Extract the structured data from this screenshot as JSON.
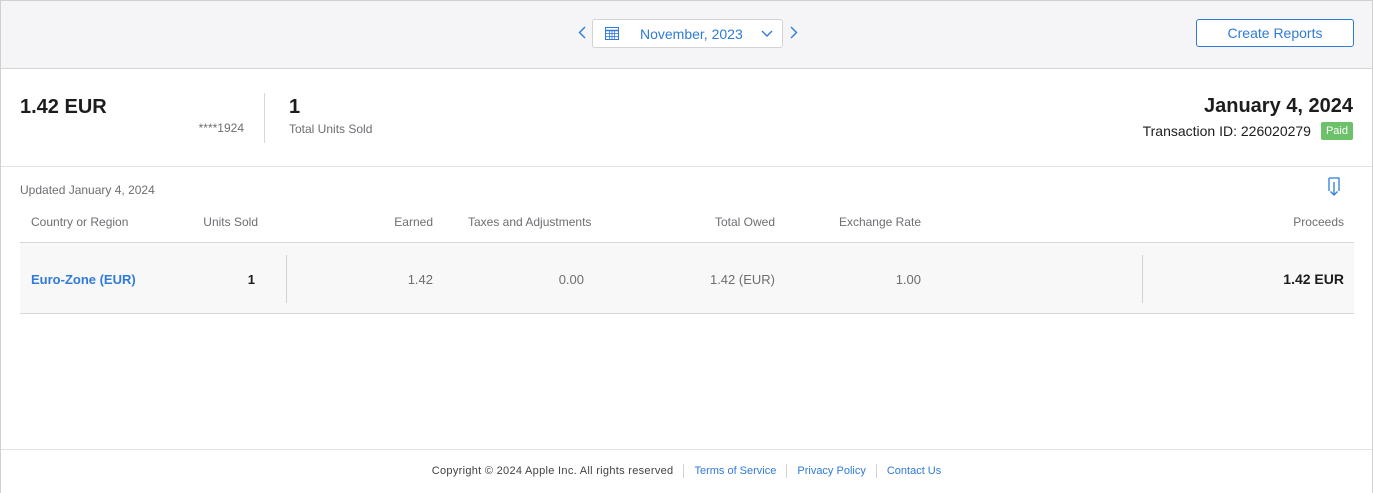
{
  "header": {
    "month": "November, 2023",
    "create_reports_label": "Create Reports",
    "icons": {
      "prev": "chevron-left-icon",
      "next": "chevron-right-icon",
      "calendar": "calendar-icon",
      "dropdown": "chevron-down-icon"
    }
  },
  "summary": {
    "amount": "1.42 EUR",
    "account": "****1924",
    "units_sold": "1",
    "units_sold_label": "Total Units Sold",
    "payment_date": "January 4, 2024",
    "transaction_id": "Transaction ID: 226020279",
    "status": "Paid"
  },
  "details": {
    "updated": "Updated January 4, 2024",
    "download_icon": "download-icon",
    "columns": {
      "country": "Country or Region",
      "units": "Units Sold",
      "earned": "Earned",
      "taxes": "Taxes and Adjustments",
      "owed": "Total Owed",
      "rate": "Exchange Rate",
      "proceeds": "Proceeds"
    },
    "row": {
      "country": "Euro-Zone (EUR)",
      "units": "1",
      "earned": "1.42",
      "taxes": "0.00",
      "owed": "1.42 (EUR)",
      "rate": "1.00",
      "proceeds": "1.42 EUR"
    }
  },
  "footer": {
    "copyright": "Copyright © 2024 Apple Inc. All rights reserved",
    "terms": "Terms of Service",
    "privacy": "Privacy Policy",
    "contact": "Contact Us"
  },
  "colors": {
    "accent": "#2f7bd9",
    "paid_badge": "#6cc16a",
    "topbar_bg": "#f5f5f7"
  }
}
